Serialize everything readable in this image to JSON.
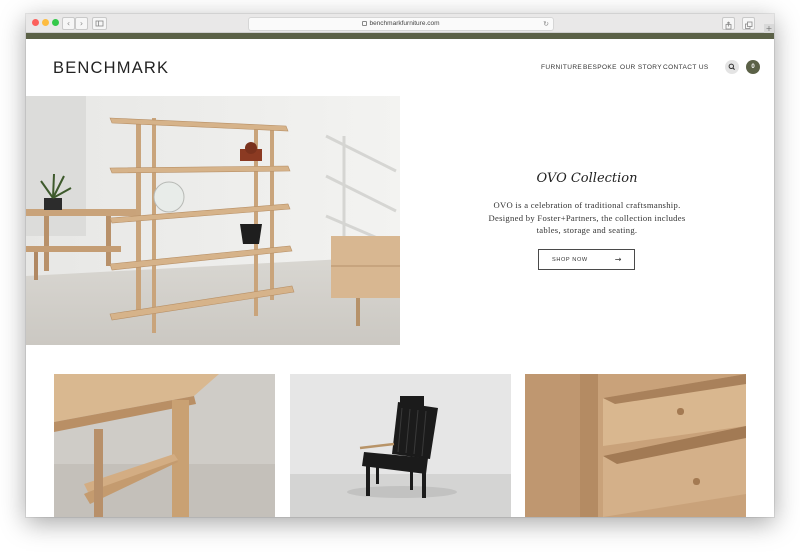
{
  "browser": {
    "url": "benchmarkfurniture.com",
    "new_tab_glyph": "+",
    "back_glyph": "‹",
    "forward_glyph": "›",
    "reload_glyph": "↻"
  },
  "brand": {
    "logo": "BENCHMARK",
    "accent_color": "#5b6147"
  },
  "nav": {
    "items": [
      "FURNITURE",
      "BESPOKE",
      "OUR STORY",
      "CONTACT US"
    ]
  },
  "header_actions": {
    "search_icon": "search-icon",
    "cart_count": "0"
  },
  "hero": {
    "title": "OVO Collection",
    "lines": [
      "OVO is a celebration of traditional craftsmanship.",
      "Designed by Foster+Partners, the collection includes",
      "tables, storage and seating."
    ],
    "button_label": "SHOP NOW",
    "button_arrow": "→"
  }
}
